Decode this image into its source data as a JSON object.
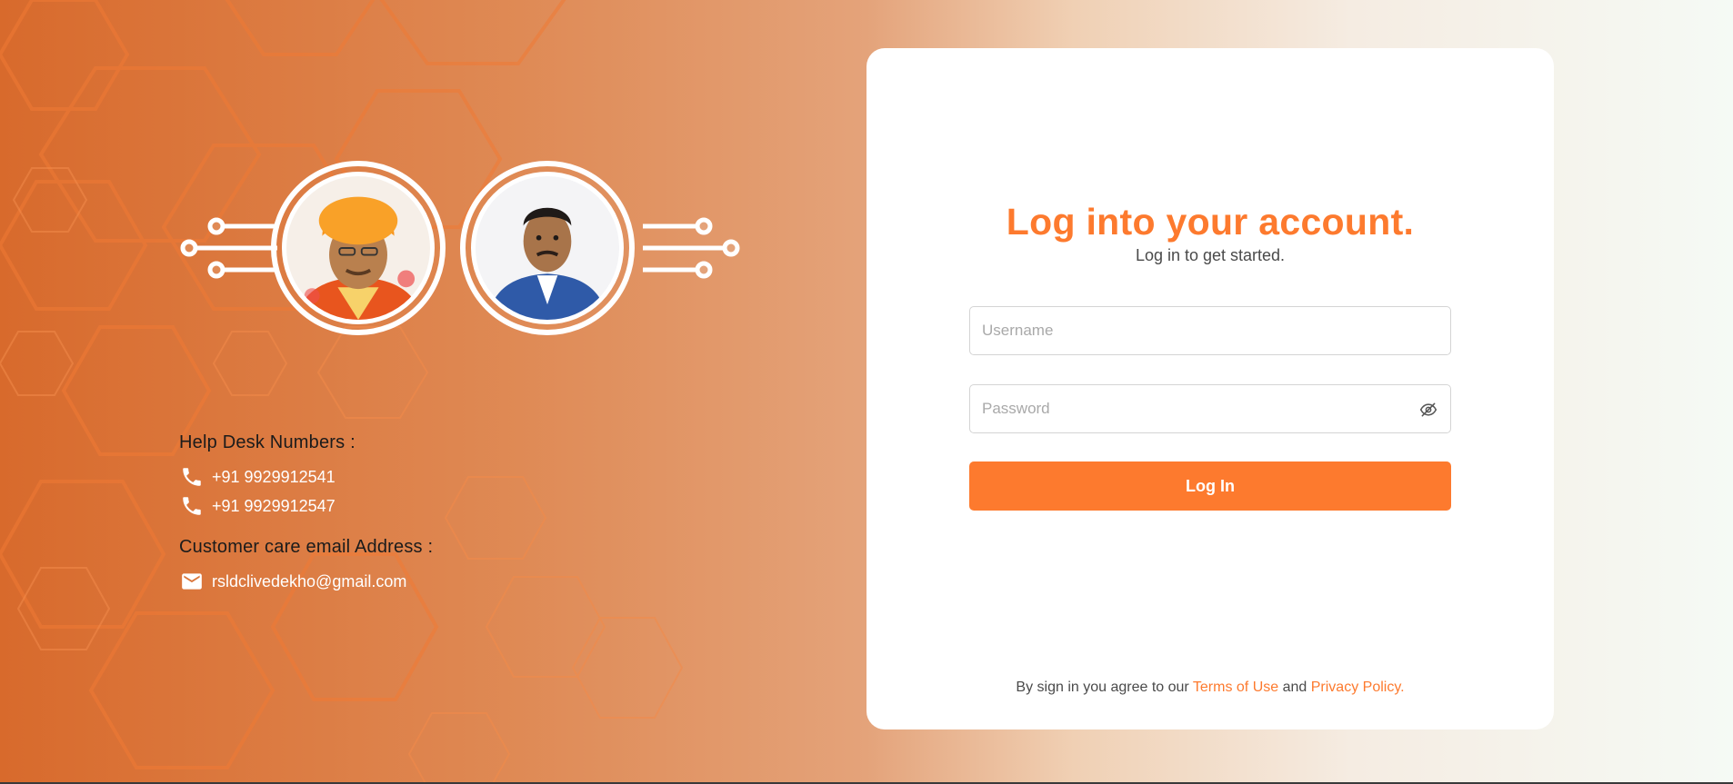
{
  "colors": {
    "accent": "#fd7a2e",
    "background_left": "#d86a2c",
    "background_right": "#f5faf5",
    "hexagon_stroke": "#f07a35"
  },
  "left_panel": {
    "portraits": [
      {
        "name": "portrait-left",
        "turban_color": "#f7941d"
      },
      {
        "name": "portrait-right",
        "jacket_color": "#2f5aa8"
      }
    ],
    "helpdesk": {
      "heading": "Help Desk Numbers :",
      "phones": [
        {
          "icon": "phone-icon",
          "number": "+91 9929912541"
        },
        {
          "icon": "phone-icon",
          "number": "+91 9929912547"
        }
      ],
      "email_heading": "Customer care email Address :",
      "email": {
        "icon": "mail-icon",
        "address": "rsldclivedekho@gmail.com"
      }
    }
  },
  "login": {
    "title": "Log into your account.",
    "subtitle": "Log in to get started.",
    "username": {
      "placeholder": "Username",
      "value": ""
    },
    "password": {
      "placeholder": "Password",
      "value": "",
      "toggle_icon": "eye-off-icon"
    },
    "submit_label": "Log In",
    "terms": {
      "prefix": "By sign in you agree to our ",
      "terms_link": "Terms of Use",
      "middle": " and ",
      "privacy_link": "Privacy Policy."
    }
  }
}
